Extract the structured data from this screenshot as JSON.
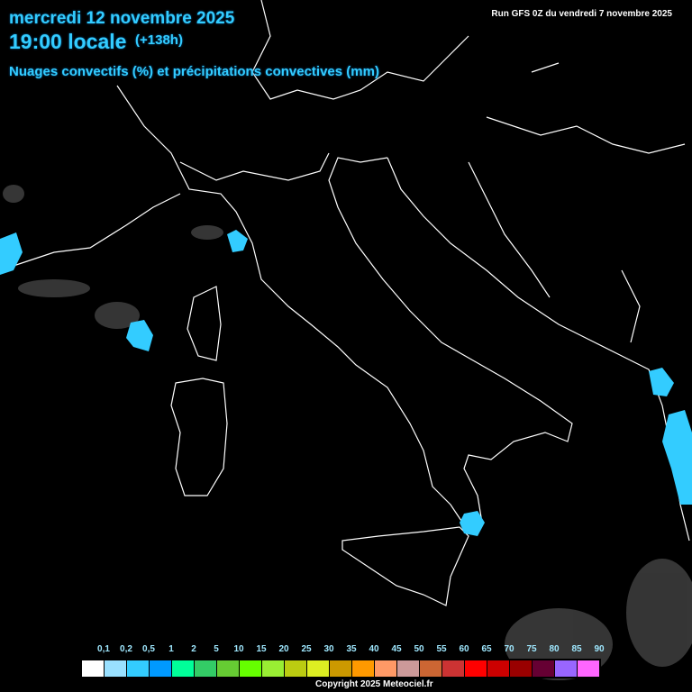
{
  "header": {
    "date": "mercredi 12 novembre 2025",
    "time": "19:00 locale",
    "lead": "(+138h)",
    "parameter": "Nuages convectifs (%) et précipitations convectives (mm)",
    "run": "Run GFS 0Z du vendredi 7 novembre 2025"
  },
  "legend": {
    "labels": [
      "0,1",
      "0,2",
      "0,5",
      "1",
      "2",
      "5",
      "10",
      "15",
      "20",
      "25",
      "30",
      "35",
      "40",
      "45",
      "50",
      "55",
      "60",
      "65",
      "70",
      "75",
      "80",
      "85",
      "90"
    ],
    "colors": [
      "#ffffff",
      "#99e0ff",
      "#33ccff",
      "#0099ff",
      "#00ff99",
      "#33cc66",
      "#66cc33",
      "#66ff00",
      "#99ee33",
      "#bbcc11",
      "#ddee22",
      "#cc9900",
      "#ff9900",
      "#ff9966",
      "#cc9999",
      "#cc6633",
      "#cc3333",
      "#ff0000",
      "#cc0000",
      "#990000",
      "#660033",
      "#9966ff",
      "#ff66ff"
    ]
  },
  "colors": {
    "precip": "#33ccff",
    "coast": "#ffffff",
    "cloud": "#888888"
  },
  "footer": {
    "copyright": "Copyright 2025 Meteociel.fr"
  }
}
